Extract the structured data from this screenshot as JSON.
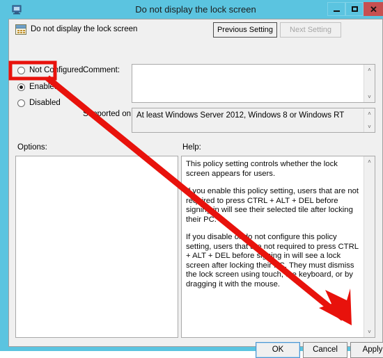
{
  "window": {
    "title": "Do not display the lock screen",
    "icon": "group-policy-editor-icon",
    "controls": {
      "minimize": "─",
      "maximize": "□",
      "close": "✕"
    }
  },
  "header": {
    "policy_name": "Do not display the lock screen",
    "previous_setting": "Previous Setting",
    "next_setting": "Next Setting"
  },
  "state_options": [
    {
      "label": "Not Configured",
      "selected": false
    },
    {
      "label": "Enabled",
      "selected": true
    },
    {
      "label": "Disabled",
      "selected": false
    }
  ],
  "fields": {
    "comment_label": "Comment:",
    "comment_value": "",
    "supported_label": "Supported on:",
    "supported_value": "At least Windows Server 2012, Windows 8 or Windows RT"
  },
  "panels": {
    "options_label": "Options:",
    "options_value": "",
    "help_label": "Help:",
    "help_paragraphs": [
      "This policy setting controls whether the lock screen appears for users.",
      "If you enable this policy setting, users that are not required to press CTRL + ALT + DEL before signing in will see their selected tile after  locking their PC.",
      "If you disable or do not configure this policy setting, users that are not required to press CTRL + ALT + DEL before signing in will see a lock screen after locking their PC. They must dismiss the lock screen using touch, the keyboard, or by dragging it with the mouse."
    ]
  },
  "footer": {
    "ok": "OK",
    "cancel": "Cancel",
    "apply": "Apply"
  },
  "scrollbars": {
    "up_arrow": "˄",
    "down_arrow": "˅"
  },
  "annotation": {
    "highlight_target": "Enabled",
    "arrow_points_to": "Apply",
    "color": "#e8120c"
  },
  "colors": {
    "title_bar": "#5bc4e0",
    "close_button": "#c75050",
    "dialog_background": "#f0f0f0",
    "annotation_red": "#e8120c",
    "focus_blue": "#4b96d0"
  }
}
